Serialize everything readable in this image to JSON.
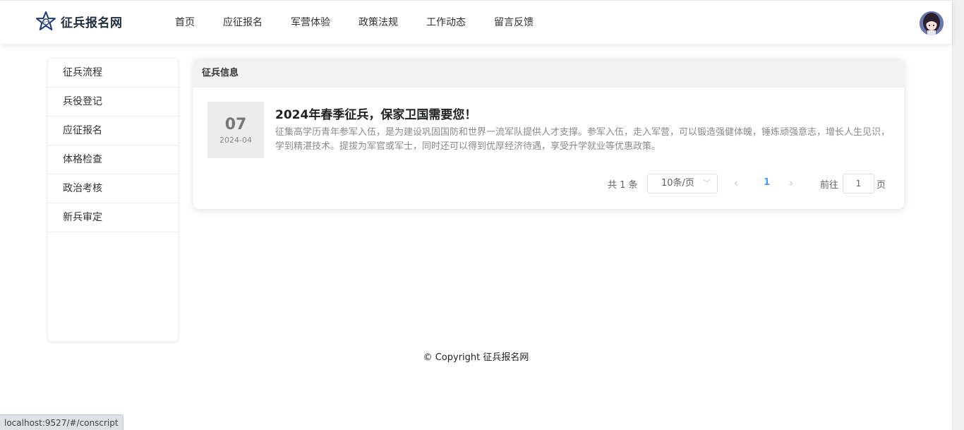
{
  "site": {
    "name": "征兵报名网"
  },
  "nav": {
    "items": [
      "首页",
      "应征报名",
      "军营体验",
      "政策法规",
      "工作动态",
      "留言反馈"
    ]
  },
  "sidebar": {
    "items": [
      "征兵流程",
      "兵役登记",
      "应征报名",
      "体格检查",
      "政治考核",
      "新兵审定"
    ]
  },
  "main": {
    "section_title": "征兵信息",
    "news": [
      {
        "day": "07",
        "month": "2024-04",
        "title": "2024年春季征兵，保家卫国需要您！",
        "summary": "征集高学历青年参军入伍，是为建设巩固国防和世界一流军队提供人才支撑。参军入伍，走入军营，可以锻造强健体魄，锤炼顽强意志，增长人生见识，学到精湛技术。提拔为军官或军士，同时还可以得到优厚经济待遇，享受升学就业等优惠政策。"
      }
    ],
    "pagination": {
      "total_text": "共 1 条",
      "page_size": "10条/页",
      "current_page": "1",
      "goto_prefix": "前往",
      "goto_value": "1",
      "goto_suffix": "页"
    }
  },
  "footer": {
    "copyright": "© Copyright 征兵报名网"
  },
  "statusbar": {
    "url": "localhost:9527/#/conscript"
  },
  "colors": {
    "accent": "#409eff",
    "logo": "#1f3a7a"
  }
}
